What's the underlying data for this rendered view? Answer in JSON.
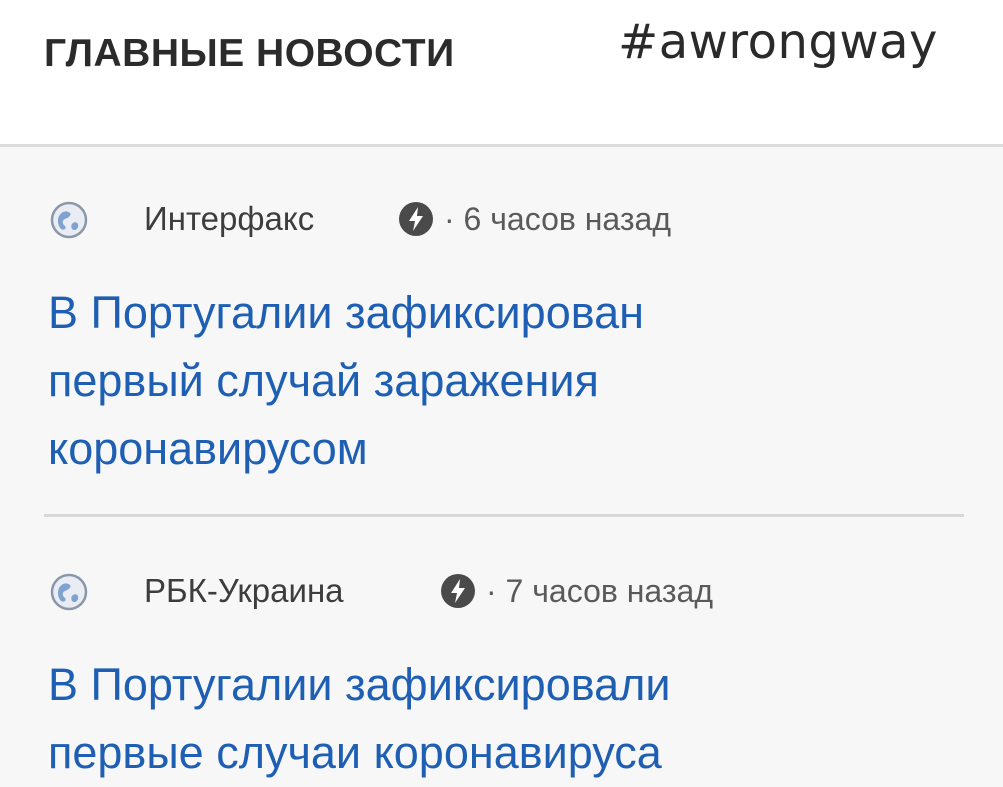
{
  "header": {
    "section_title": "ГЛАВНЫЕ НОВОСТИ",
    "hashtag": "#awrongway"
  },
  "news": [
    {
      "source_icon": "globe-icon",
      "source": "Интерфакс",
      "badge_icon": "bolt-icon",
      "time": "· 6 часов назад",
      "headline_lines": [
        "В Португалии зафиксирован",
        "первый случай заражения",
        "коронавирусом"
      ]
    },
    {
      "source_icon": "globe-icon",
      "source": "РБК-Украина",
      "badge_icon": "bolt-icon",
      "time": "· 7 часов назад",
      "headline_lines": [
        "В Португалии зафиксировали",
        "первые случаи коронавируса"
      ]
    }
  ],
  "colors": {
    "headline": "#1e5fb4",
    "meta_text": "#3d3d3d",
    "background": "#f7f7f7",
    "divider": "#d8d8d8"
  }
}
